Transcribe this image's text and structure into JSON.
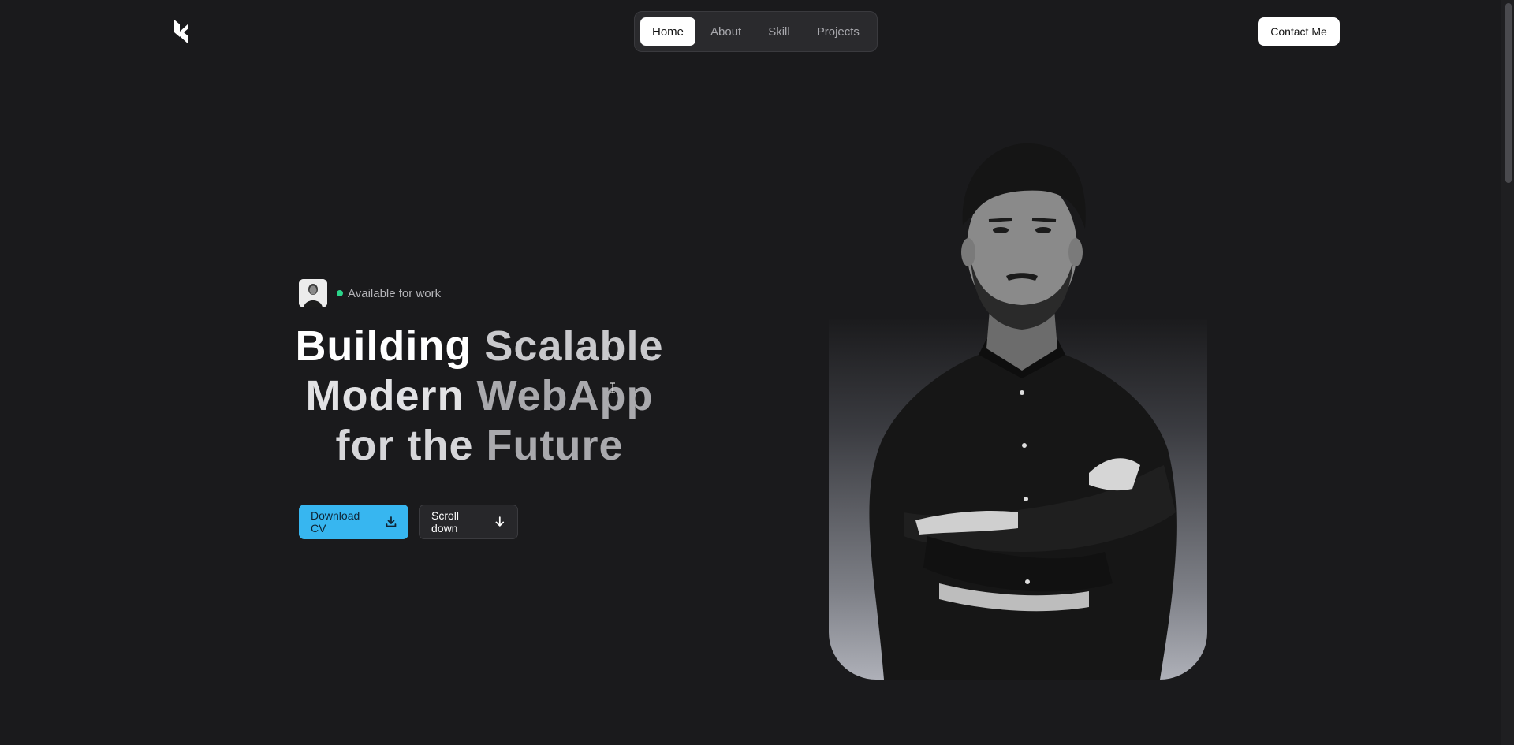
{
  "header": {
    "logo_icon": "brand-logo-icon",
    "nav": [
      {
        "label": "Home",
        "active": true
      },
      {
        "label": "About",
        "active": false
      },
      {
        "label": "Skill",
        "active": false
      },
      {
        "label": "Projects",
        "active": false
      }
    ],
    "contact_label": "Contact Me"
  },
  "hero": {
    "availability": "Available for work",
    "status_color": "#2bd48a",
    "headline": {
      "line1": [
        "Building",
        "Scalable"
      ],
      "line2": [
        "Modern",
        "WebApp"
      ],
      "line3": [
        "for the",
        "Future"
      ]
    },
    "download_label": "Download CV",
    "download_icon": "download-icon",
    "scroll_label": "Scroll down",
    "scroll_icon": "arrow-down-icon"
  },
  "colors": {
    "background": "#1a1a1c",
    "accent": "#37b6f0"
  }
}
